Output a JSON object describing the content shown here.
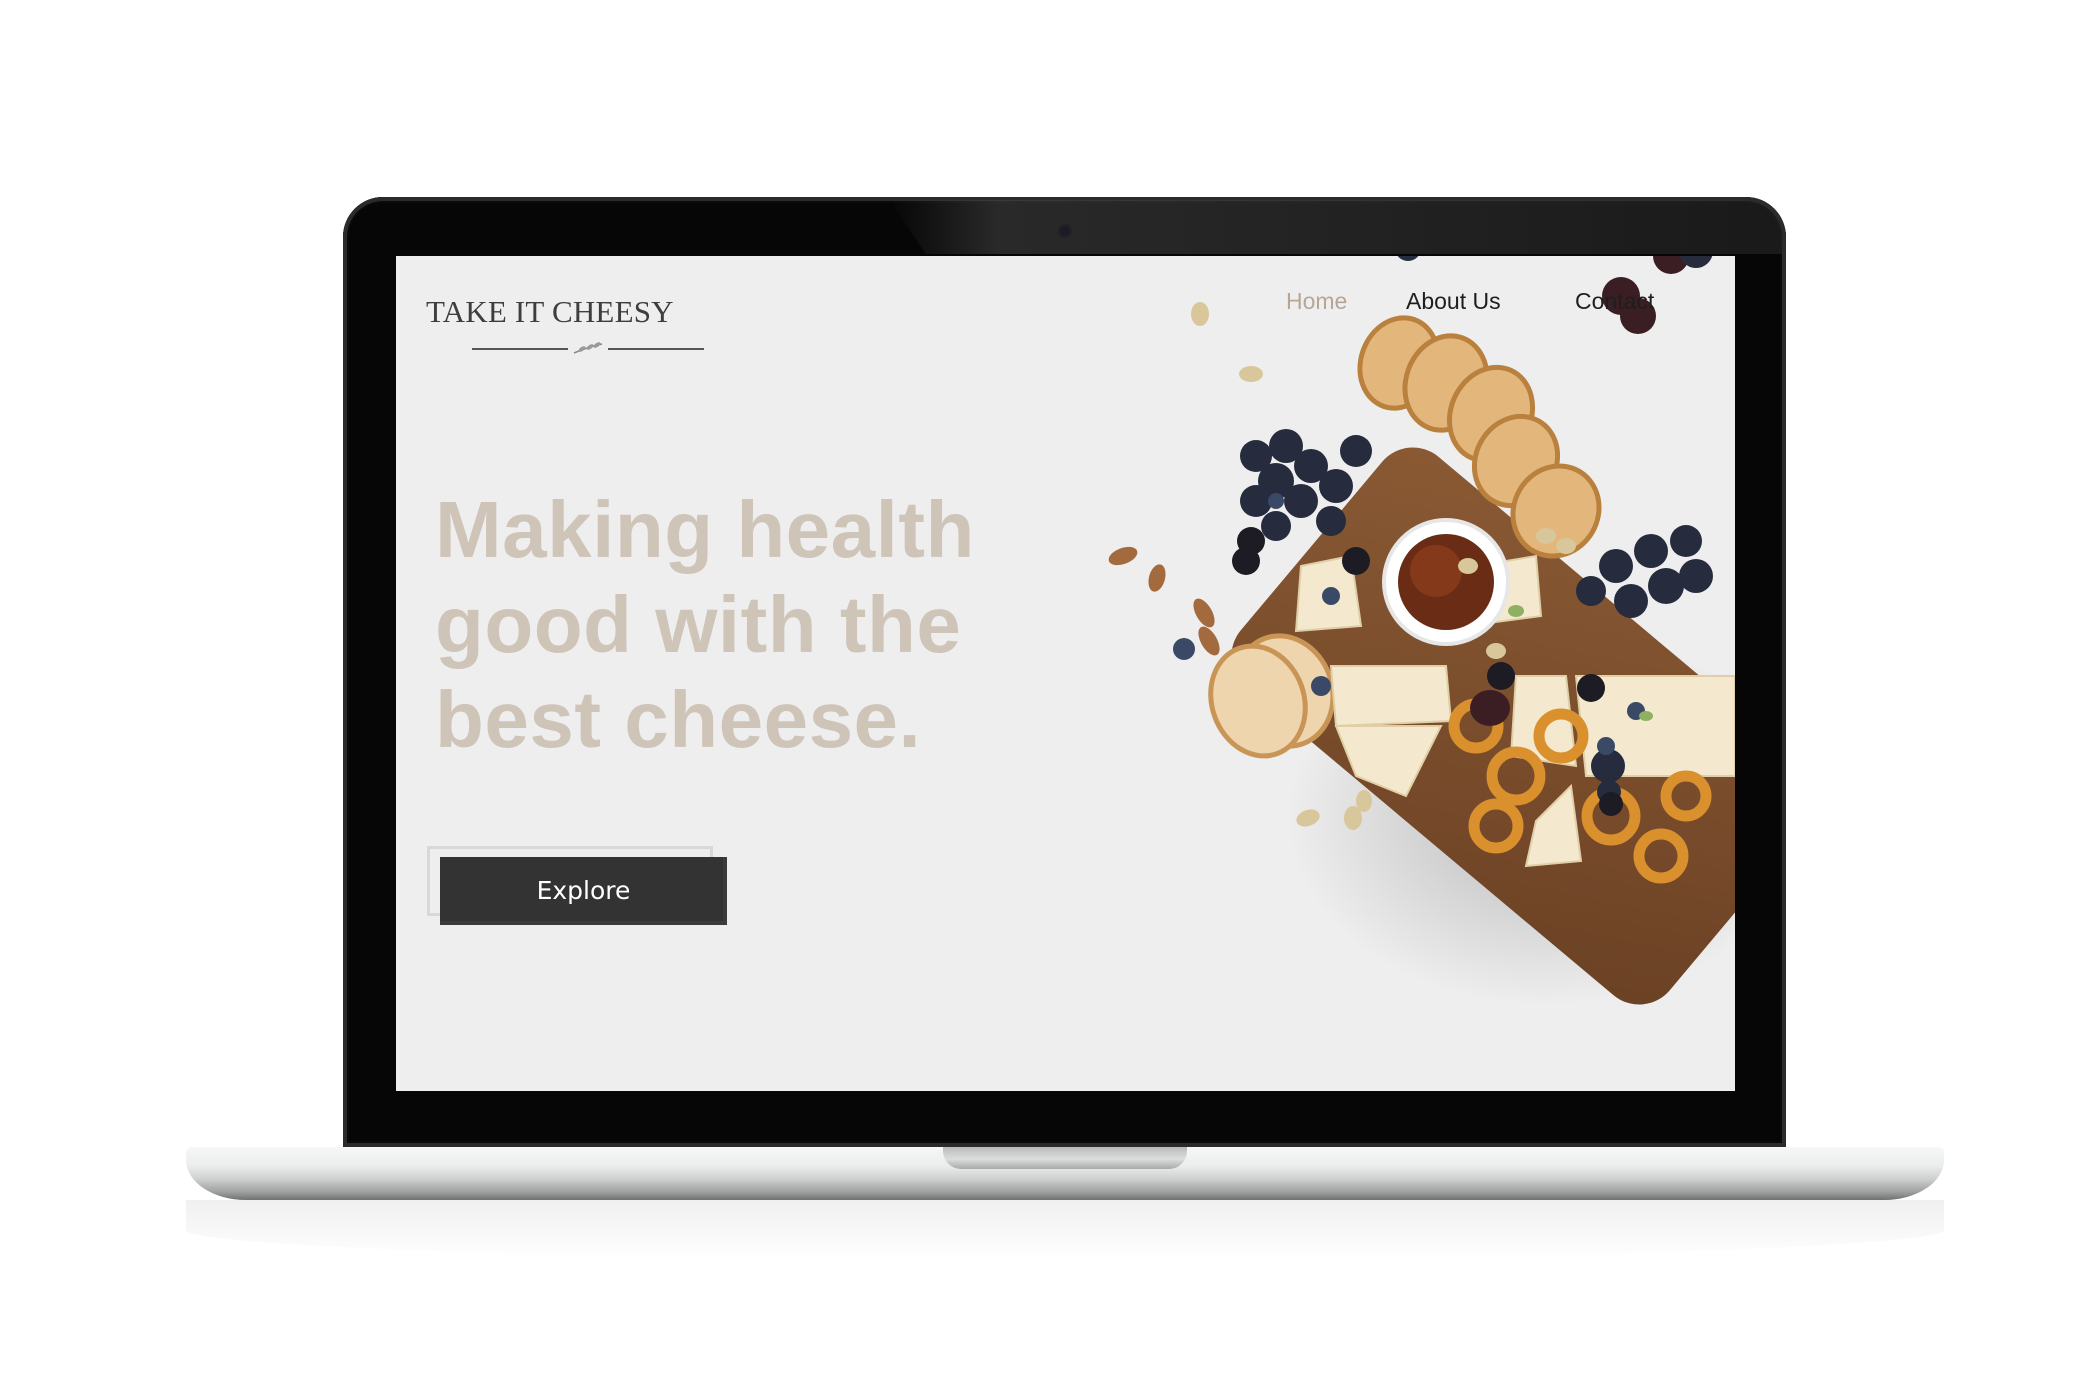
{
  "site": {
    "logo_text": "TAKE IT CHEESY",
    "nav": {
      "home": "Home",
      "about": "About Us",
      "contact": "Contact"
    },
    "hero": {
      "line1": "Making health",
      "line2": "good with the",
      "line3": "best cheese.",
      "cta_label": "Explore"
    }
  },
  "colors": {
    "page_background": "#efeeee",
    "headline": "#cfc4b8",
    "nav_active": "#b7a695",
    "nav_default": "#1e1e1e",
    "button": "#333333"
  },
  "icons": {
    "logo_ornament": "leaf-sprig-icon",
    "camera": "webcam-dot"
  }
}
